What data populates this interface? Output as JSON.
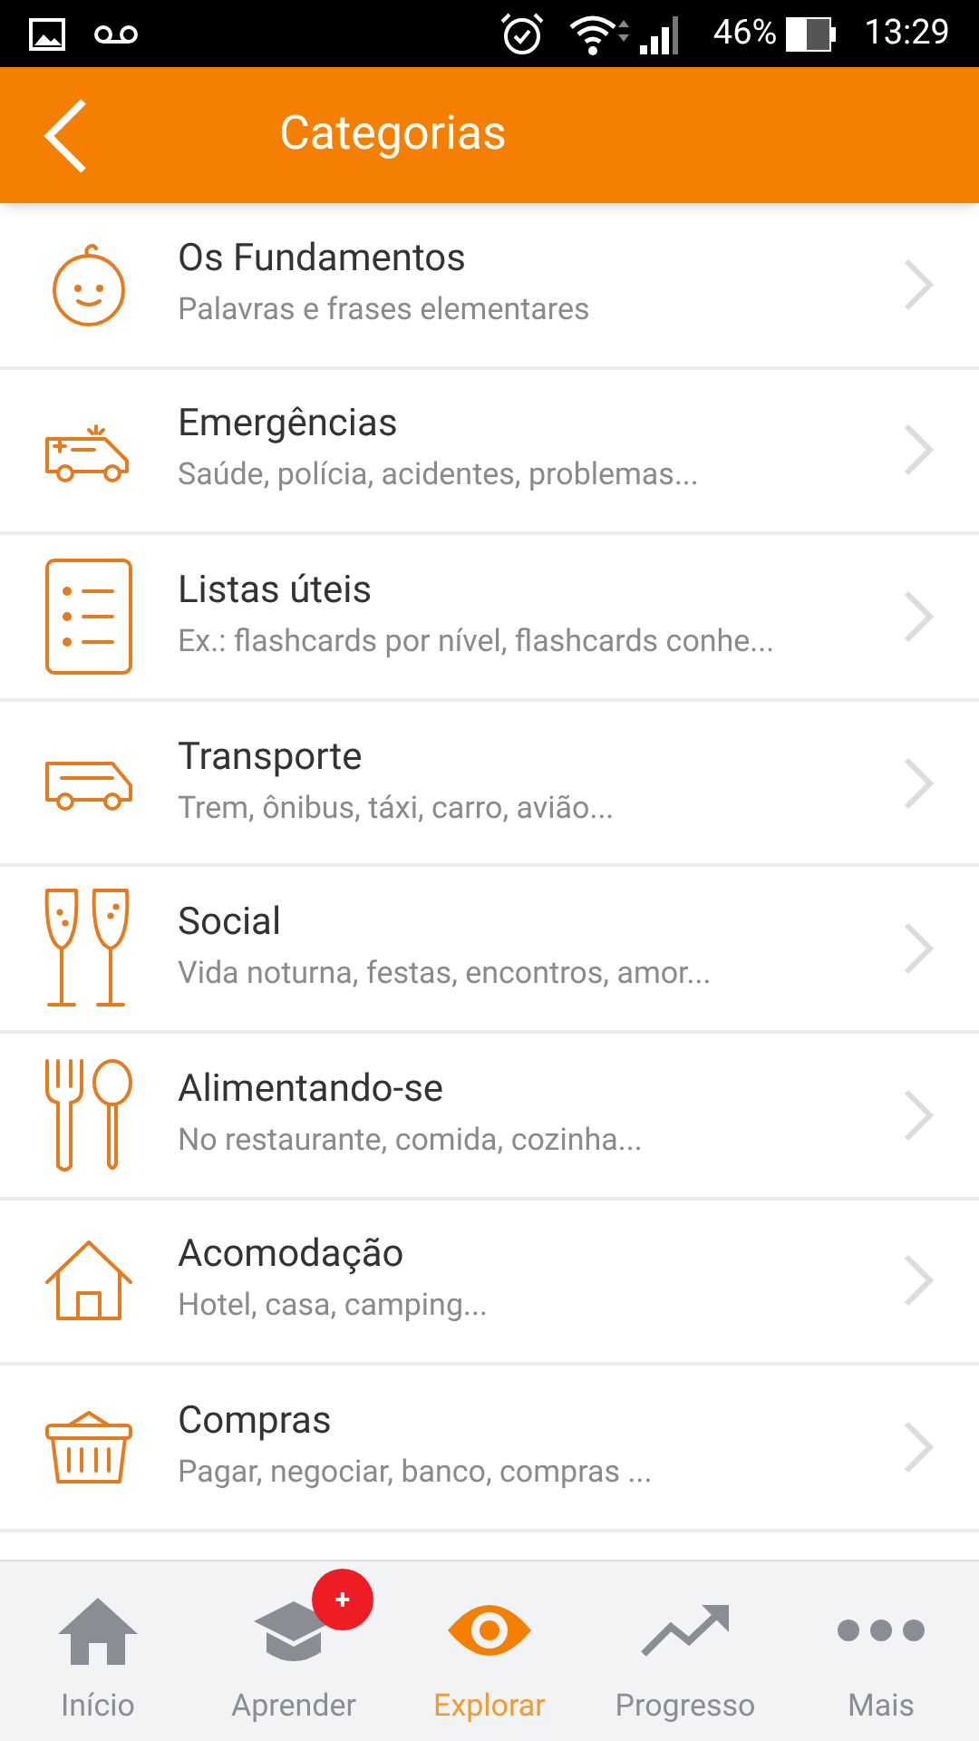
{
  "status_bar": {
    "battery": "46%",
    "time": "13:29"
  },
  "header": {
    "title": "Categorias"
  },
  "categories": [
    {
      "kind": "baby",
      "title": "Os Fundamentos",
      "subtitle": "Palavras e frases elementares"
    },
    {
      "kind": "ambulance",
      "title": "Emergências",
      "subtitle": "Saúde, polícia, acidentes, problemas..."
    },
    {
      "kind": "list",
      "title": "Listas úteis",
      "subtitle": "Ex.: flashcards por nível, flashcards conhe..."
    },
    {
      "kind": "van",
      "title": "Transporte",
      "subtitle": "Trem, ônibus, táxi, carro, avião..."
    },
    {
      "kind": "glasses",
      "title": "Social",
      "subtitle": "Vida noturna, festas, encontros, amor..."
    },
    {
      "kind": "cutlery",
      "title": "Alimentando-se",
      "subtitle": "No restaurante, comida, cozinha..."
    },
    {
      "kind": "house",
      "title": "Acomodação",
      "subtitle": "Hotel, casa, camping..."
    },
    {
      "kind": "basket",
      "title": "Compras",
      "subtitle": "Pagar, negociar, banco, compras ..."
    }
  ],
  "bottom_nav": [
    {
      "kind": "home",
      "label": "Início",
      "selected": false
    },
    {
      "kind": "cap",
      "label": "Aprender",
      "selected": false,
      "badge": "+"
    },
    {
      "kind": "eye",
      "label": "Explorar",
      "selected": true
    },
    {
      "kind": "trend",
      "label": "Progresso",
      "selected": false
    },
    {
      "kind": "dots",
      "label": "Mais",
      "selected": false
    }
  ]
}
